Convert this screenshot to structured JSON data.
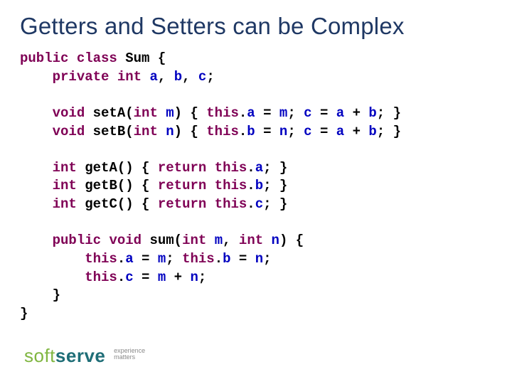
{
  "title": "Getters and Setters can be Complex",
  "code": {
    "tokens": {
      "public": "public",
      "class": "class",
      "Sum": "Sum",
      "private": "private",
      "int": "int",
      "void": "void",
      "this": "this",
      "return": "return",
      "a": "a",
      "b": "b",
      "c": "c",
      "m": "m",
      "n": "n",
      "setA": "setA",
      "setB": "setB",
      "getA": "getA",
      "getB": "getB",
      "getC": "getC",
      "sum": "sum"
    }
  },
  "logo": {
    "soft": "soft",
    "serve": "serve",
    "tag1": "experience",
    "tag2": "matters"
  }
}
